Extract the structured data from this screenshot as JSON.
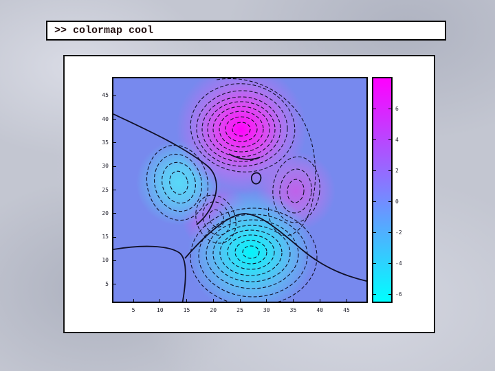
{
  "slide": {
    "command_box": {
      "prompt": ">> colormap cool",
      "text_color": "#241212",
      "background": "#ffffff",
      "border_color": "#000000"
    },
    "background_color": "#c3c6d1",
    "figure_background": "#ffffff"
  },
  "chart_data": {
    "type": "heatmap",
    "subtype": "filled-contour-with-lines",
    "notes": "MATLAB peaks surface rendered with interpolated shading and black contour lines, colormap cool (magenta to cyan), with vertical colorbar",
    "title": "",
    "xlabel": "",
    "ylabel": "",
    "x_range": [
      1,
      49
    ],
    "y_range": [
      1,
      49
    ],
    "z_range": [
      -6.55,
      8.08
    ],
    "x_ticks": [
      5,
      10,
      15,
      20,
      25,
      30,
      35,
      40,
      45
    ],
    "y_ticks": [
      5,
      10,
      15,
      20,
      25,
      30,
      35,
      40,
      45
    ],
    "grid": false,
    "legend": false,
    "background_level_color": "#7789ee",
    "contour_line_color": "#101028",
    "contour_line_styles": {
      "zero_level": "solid",
      "other_levels": "dashed"
    },
    "features": [
      {
        "name": "global-maximum",
        "x": 25,
        "y": 38,
        "z": 8.1,
        "color": "#ff00fc"
      },
      {
        "name": "local-minimum",
        "x": 14,
        "y": 27,
        "z": -3.0,
        "color": "#58d9f8"
      },
      {
        "name": "global-minimum",
        "x": 27,
        "y": 12,
        "z": -6.5,
        "color": "#04f4fb"
      },
      {
        "name": "local-maximum",
        "x": 21,
        "y": 19,
        "z": 3.6,
        "color": "#c257ee"
      },
      {
        "name": "local-maximum",
        "x": 35,
        "y": 25,
        "z": 3.6,
        "color": "#bf62ea"
      }
    ],
    "colorbar": {
      "position": "right",
      "ticks": [
        "6",
        "4",
        "2",
        "0",
        "-2",
        "-4",
        "-6"
      ],
      "tick_values": [
        6,
        4,
        2,
        0,
        -2,
        -4,
        -6
      ],
      "top_value": 8.08,
      "bottom_value": -6.55,
      "top_color": "#ff00ff",
      "bottom_color": "#00ffff"
    }
  }
}
